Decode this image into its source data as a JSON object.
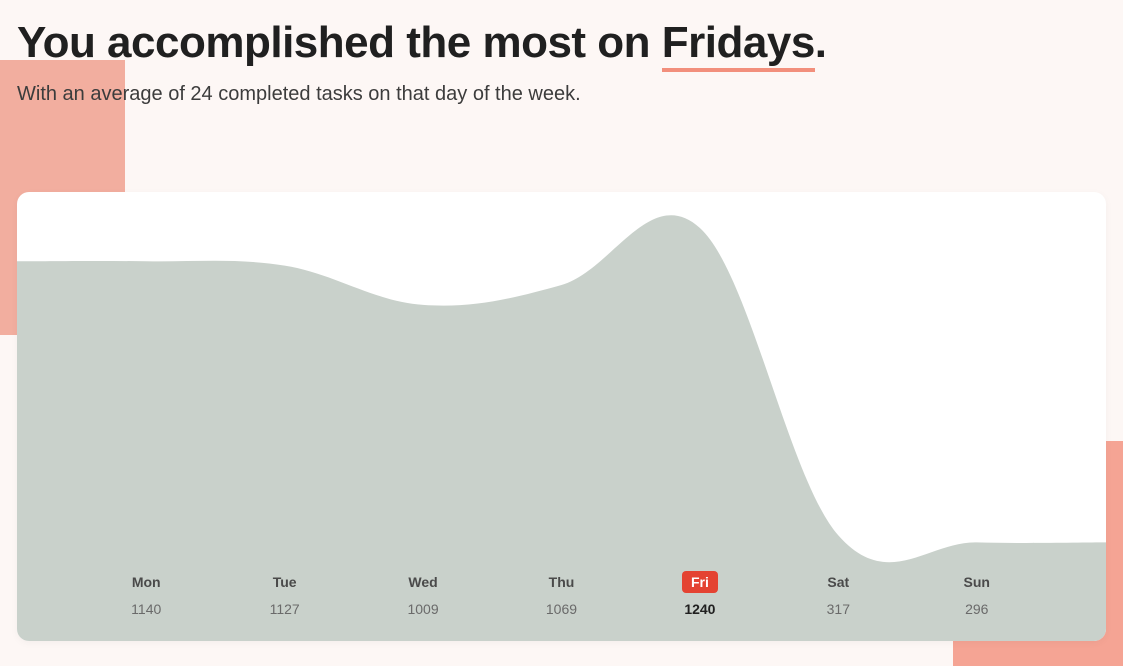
{
  "heading": {
    "prefix": "You accomplished the most on ",
    "highlight": "Fridays",
    "suffix": "."
  },
  "subtitle": "With an average of 24 completed tasks on that day of the week.",
  "chart_data": {
    "type": "area",
    "categories": [
      "Mon",
      "Tue",
      "Wed",
      "Thu",
      "Fri",
      "Sat",
      "Sun"
    ],
    "values": [
      1140,
      1127,
      1009,
      1069,
      1240,
      317,
      296
    ],
    "highlight_index": 4,
    "ylim": [
      0,
      1300
    ],
    "colors": {
      "fill": "#c9d1cb",
      "accent": "#e44332"
    }
  }
}
